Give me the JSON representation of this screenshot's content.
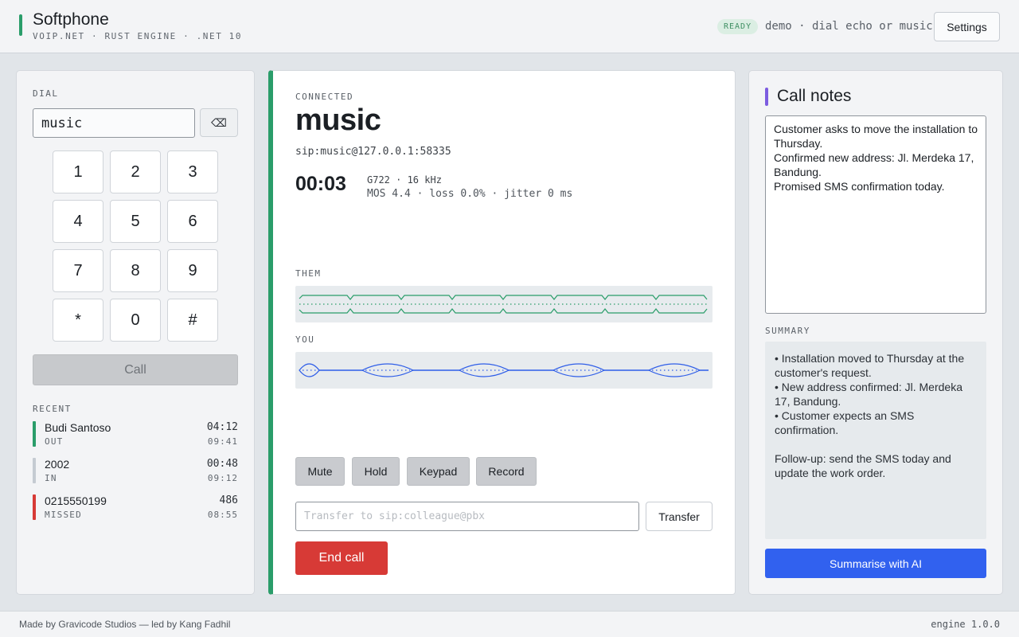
{
  "header": {
    "title": "Softphone",
    "subtitle": "VOIP.NET · RUST ENGINE · .NET 10",
    "status_badge": "READY",
    "status_text": "demo · dial echo or music",
    "settings_label": "Settings"
  },
  "dialer": {
    "label": "DIAL",
    "input_value": "music",
    "backspace_label": "⌫",
    "keys": [
      "1",
      "2",
      "3",
      "4",
      "5",
      "6",
      "7",
      "8",
      "9",
      "*",
      "0",
      "#"
    ],
    "call_label": "Call"
  },
  "recent": {
    "label": "RECENT",
    "items": [
      {
        "name": "Budi Santoso",
        "direction": "OUT",
        "duration": "04:12",
        "time": "09:41",
        "color": "#2a9d6a"
      },
      {
        "name": "2002",
        "direction": "IN",
        "duration": "00:48",
        "time": "09:12",
        "color": "#c5cbd2"
      },
      {
        "name": "0215550199",
        "direction": "MISSED",
        "duration": "486",
        "time": "08:55",
        "color": "#d73a36"
      }
    ]
  },
  "call": {
    "state": "CONNECTED",
    "name": "music",
    "uri": "sip:music@127.0.0.1:58335",
    "timer": "00:03",
    "codec": "G722 · 16 kHz",
    "metrics": "MOS 4.4 · loss 0.0% · jitter 0 ms",
    "them_label": "THEM",
    "you_label": "YOU",
    "them_color": "#2a9d6a",
    "you_color": "#2f5ee8",
    "controls": {
      "mute": "Mute",
      "hold": "Hold",
      "keypad": "Keypad",
      "record": "Record"
    },
    "transfer_placeholder": "Transfer to sip:colleague@pbx",
    "transfer_label": "Transfer",
    "end_label": "End call"
  },
  "notes": {
    "title": "Call notes",
    "text": "Customer asks to move the installation to Thursday.\nConfirmed new address: Jl. Merdeka 17, Bandung.\nPromised SMS confirmation today.",
    "summary_label": "SUMMARY",
    "summary_text": "• Installation moved to Thursday at the customer's request.\n• New address confirmed: Jl. Merdeka 17, Bandung.\n• Customer expects an SMS confirmation.\n\nFollow-up: send the SMS today and update the work order.",
    "ai_button_label": "Summarise with AI"
  },
  "footer": {
    "credit": "Made by Gravicode Studios — led by Kang Fadhil",
    "version": "engine 1.0.0"
  }
}
